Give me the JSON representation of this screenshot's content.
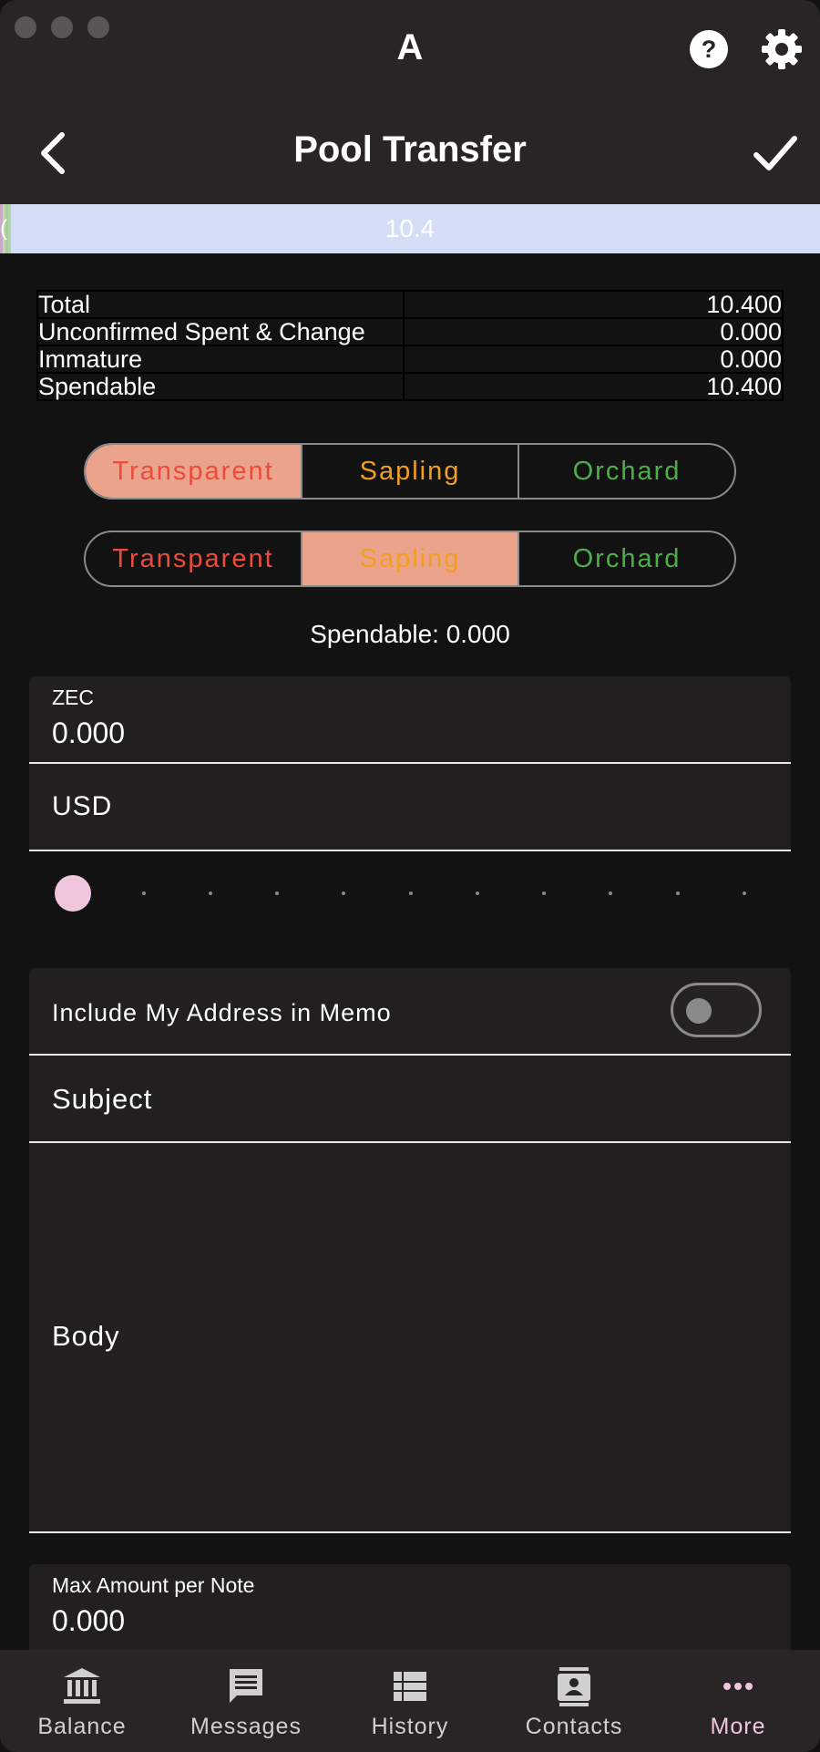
{
  "app": {
    "letter": "A"
  },
  "header": {
    "title": "Pool Transfer"
  },
  "balance_bar": {
    "value": "10.4",
    "edge_text": "("
  },
  "balances": [
    {
      "label": "Total",
      "value": "10.400"
    },
    {
      "label": "Unconfirmed Spent & Change",
      "value": "0.000"
    },
    {
      "label": "Immature",
      "value": "0.000"
    },
    {
      "label": "Spendable",
      "value": "10.400"
    }
  ],
  "from_pool": {
    "options": [
      "Transparent",
      "Sapling",
      "Orchard"
    ],
    "selected": "Transparent"
  },
  "to_pool": {
    "options": [
      "Transparent",
      "Sapling",
      "Orchard"
    ],
    "selected": "Sapling"
  },
  "spendable_text": "Spendable: 0.000",
  "amount": {
    "zec_label": "ZEC",
    "zec_value": "0.000",
    "usd_label": "USD"
  },
  "slider": {
    "level": 0
  },
  "memo": {
    "include_address_label": "Include My Address in Memo",
    "include_address_on": false,
    "subject_label": "Subject",
    "body_label": "Body"
  },
  "max_note": {
    "label": "Max Amount per Note",
    "value": "0.000"
  },
  "nav": [
    {
      "label": "Balance",
      "icon": "bank-icon"
    },
    {
      "label": "Messages",
      "icon": "message-icon"
    },
    {
      "label": "History",
      "icon": "list-icon"
    },
    {
      "label": "Contacts",
      "icon": "contacts-icon"
    },
    {
      "label": "More",
      "icon": "more-icon",
      "active": true
    }
  ],
  "colors": {
    "transparent": "#ec4b3b",
    "sapling": "#f29e1e",
    "orchard": "#4fae4a",
    "selected_bg": "#eba38c",
    "accent": "#f0c6df",
    "bar": "#d4def6"
  }
}
